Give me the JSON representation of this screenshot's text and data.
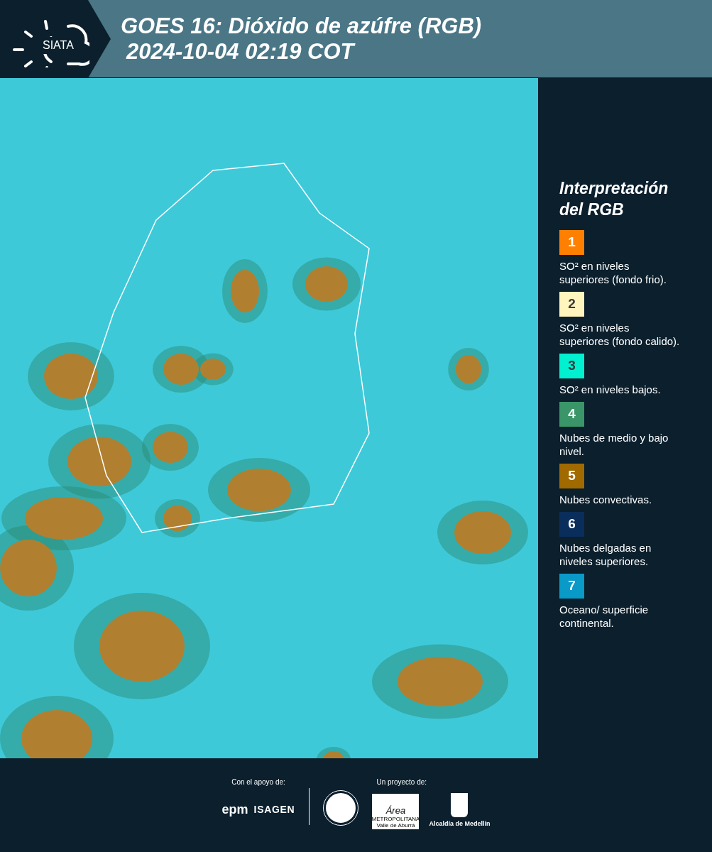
{
  "header": {
    "logo_text": "SIATA",
    "title": "GOES 16: Dióxido de azúfre (RGB)",
    "timestamp": "2024-10-04 02:19 COT"
  },
  "legend": {
    "title": "Interpretación del RGB",
    "items": [
      {
        "number": "1",
        "color": "#ff8000",
        "label": "SO² en niveles superiores (fondo frio)."
      },
      {
        "number": "2",
        "color": "#fff5bd",
        "label": "SO² en niveles superiores (fondo calido)."
      },
      {
        "number": "3",
        "color": "#00f0d0",
        "label": "SO² en niveles bajos."
      },
      {
        "number": "4",
        "color": "#3a9668",
        "label": "Nubes de medio y bajo nivel."
      },
      {
        "number": "5",
        "color": "#a06a00",
        "label": "Nubes convectivas."
      },
      {
        "number": "6",
        "color": "#0a2e5c",
        "label": "Nubes delgadas en niveles superiores."
      },
      {
        "number": "7",
        "color": "#0a9ac8",
        "label": "Oceano/ superficie continental."
      }
    ]
  },
  "footer": {
    "support_label": "Con el apoyo de:",
    "project_label": "Un proyecto de:",
    "support_logos": [
      "epm",
      "ISAGEN"
    ],
    "area_logo": {
      "title": "Área",
      "line_1": "METROPOLITANA",
      "line_2": "Valle de Aburrá"
    },
    "city_logo": "Alcaldía de Medellín"
  }
}
